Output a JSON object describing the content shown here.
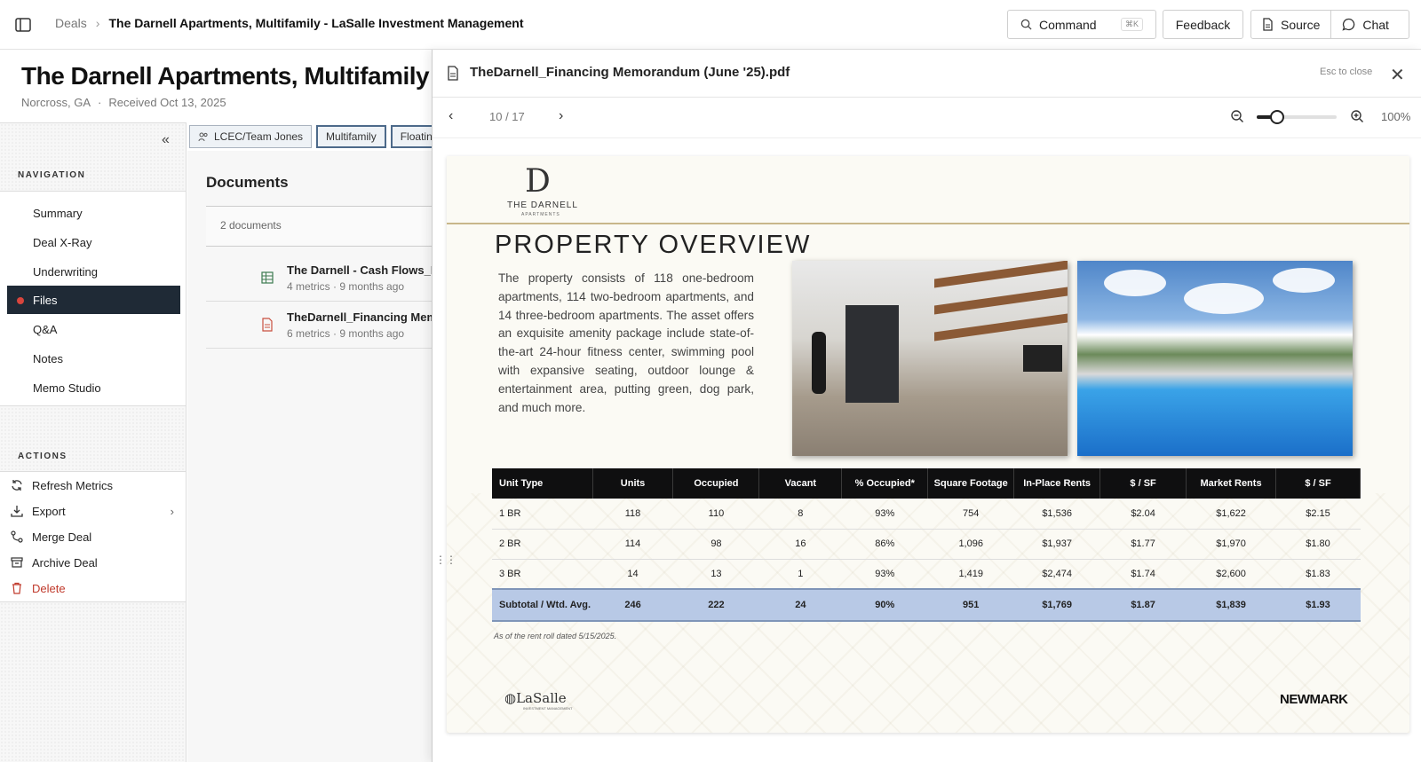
{
  "topbar": {
    "breadcrumb": {
      "root": "Deals",
      "current": "The Darnell Apartments, Multifamily - LaSalle Investment Management"
    },
    "command_label": "Command",
    "command_shortcut": "⌘K",
    "feedback_label": "Feedback",
    "source_label": "Source",
    "chat_label": "Chat"
  },
  "deal": {
    "title": "The Darnell Apartments, Multifamily - LaSalle Investment Management",
    "location": "Norcross, GA",
    "received": "Received Oct 13, 2025"
  },
  "tags": [
    "LCEC/Team Jones",
    "Multifamily",
    "Floating"
  ],
  "navigation": {
    "label": "NAVIGATION",
    "items": [
      {
        "label": "Summary"
      },
      {
        "label": "Deal X-Ray"
      },
      {
        "label": "Underwriting"
      },
      {
        "label": "Files",
        "active": true
      },
      {
        "label": "Q&A"
      },
      {
        "label": "Notes"
      },
      {
        "label": "Memo Studio"
      }
    ]
  },
  "actions": {
    "label": "ACTIONS",
    "items": [
      {
        "label": "Refresh Metrics",
        "icon": "refresh-icon"
      },
      {
        "label": "Export",
        "icon": "download-icon"
      },
      {
        "label": "Merge Deal",
        "icon": "merge-icon"
      },
      {
        "label": "Archive Deal",
        "icon": "archive-icon"
      },
      {
        "label": "Delete",
        "icon": "trash-icon"
      }
    ]
  },
  "documents": {
    "title": "Documents",
    "count": "2 documents",
    "items": [
      {
        "name": "The Darnell - Cash Flows_N",
        "meta": "4 metrics · 9 months ago",
        "icon": "spreadsheet-icon"
      },
      {
        "name": "TheDarnell_Financing Mem",
        "meta": "6 metrics · 9 months ago",
        "icon": "pdf-icon"
      }
    ]
  },
  "viewer": {
    "filename": "TheDarnell_Financing Memorandum (June '25).pdf",
    "esc_hint": "Esc to close",
    "page_indicator": "10 / 17",
    "zoom_label": "100%",
    "zoom_fraction": 0.25
  },
  "pdf_page": {
    "logo_letter": "D",
    "logo_name": "THE DARNELL",
    "logo_sub": "APARTMENTS",
    "heading": "PROPERTY OVERVIEW",
    "description": "The property consists of 118 one-bedroom apartments, 114 two-bedroom apartments, and 14 three-bedroom apartments. The asset offers an exquisite amenity package include state-of-the-art 24-hour fitness center, swimming pool with expansive seating, outdoor lounge & entertainment area, putting green, dog park, and much more.",
    "table": {
      "headers": [
        "Unit Type",
        "Units",
        "Occupied",
        "Vacant",
        "% Occupied*",
        "Square Footage",
        "In-Place Rents",
        "$ / SF",
        "Market Rents",
        "$ / SF"
      ],
      "rows": [
        [
          "1 BR",
          "118",
          "110",
          "8",
          "93%",
          "754",
          "$1,536",
          "$2.04",
          "$1,622",
          "$2.15"
        ],
        [
          "2 BR",
          "114",
          "98",
          "16",
          "86%",
          "1,096",
          "$1,937",
          "$1.77",
          "$1,970",
          "$1.80"
        ],
        [
          "3 BR",
          "14",
          "13",
          "1",
          "93%",
          "1,419",
          "$2,474",
          "$1.74",
          "$2,600",
          "$1.83"
        ]
      ],
      "subtotal": [
        "Subtotal / Wtd. Avg.",
        "246",
        "222",
        "24",
        "90%",
        "951",
        "$1,769",
        "$1.87",
        "$1,839",
        "$1.93"
      ]
    },
    "footnote": "As of the rent roll dated 5/15/2025.",
    "footer_left": "LaSalle",
    "footer_left_sub": "INVESTMENT MANAGEMENT",
    "footer_right": "NEWMARK"
  }
}
